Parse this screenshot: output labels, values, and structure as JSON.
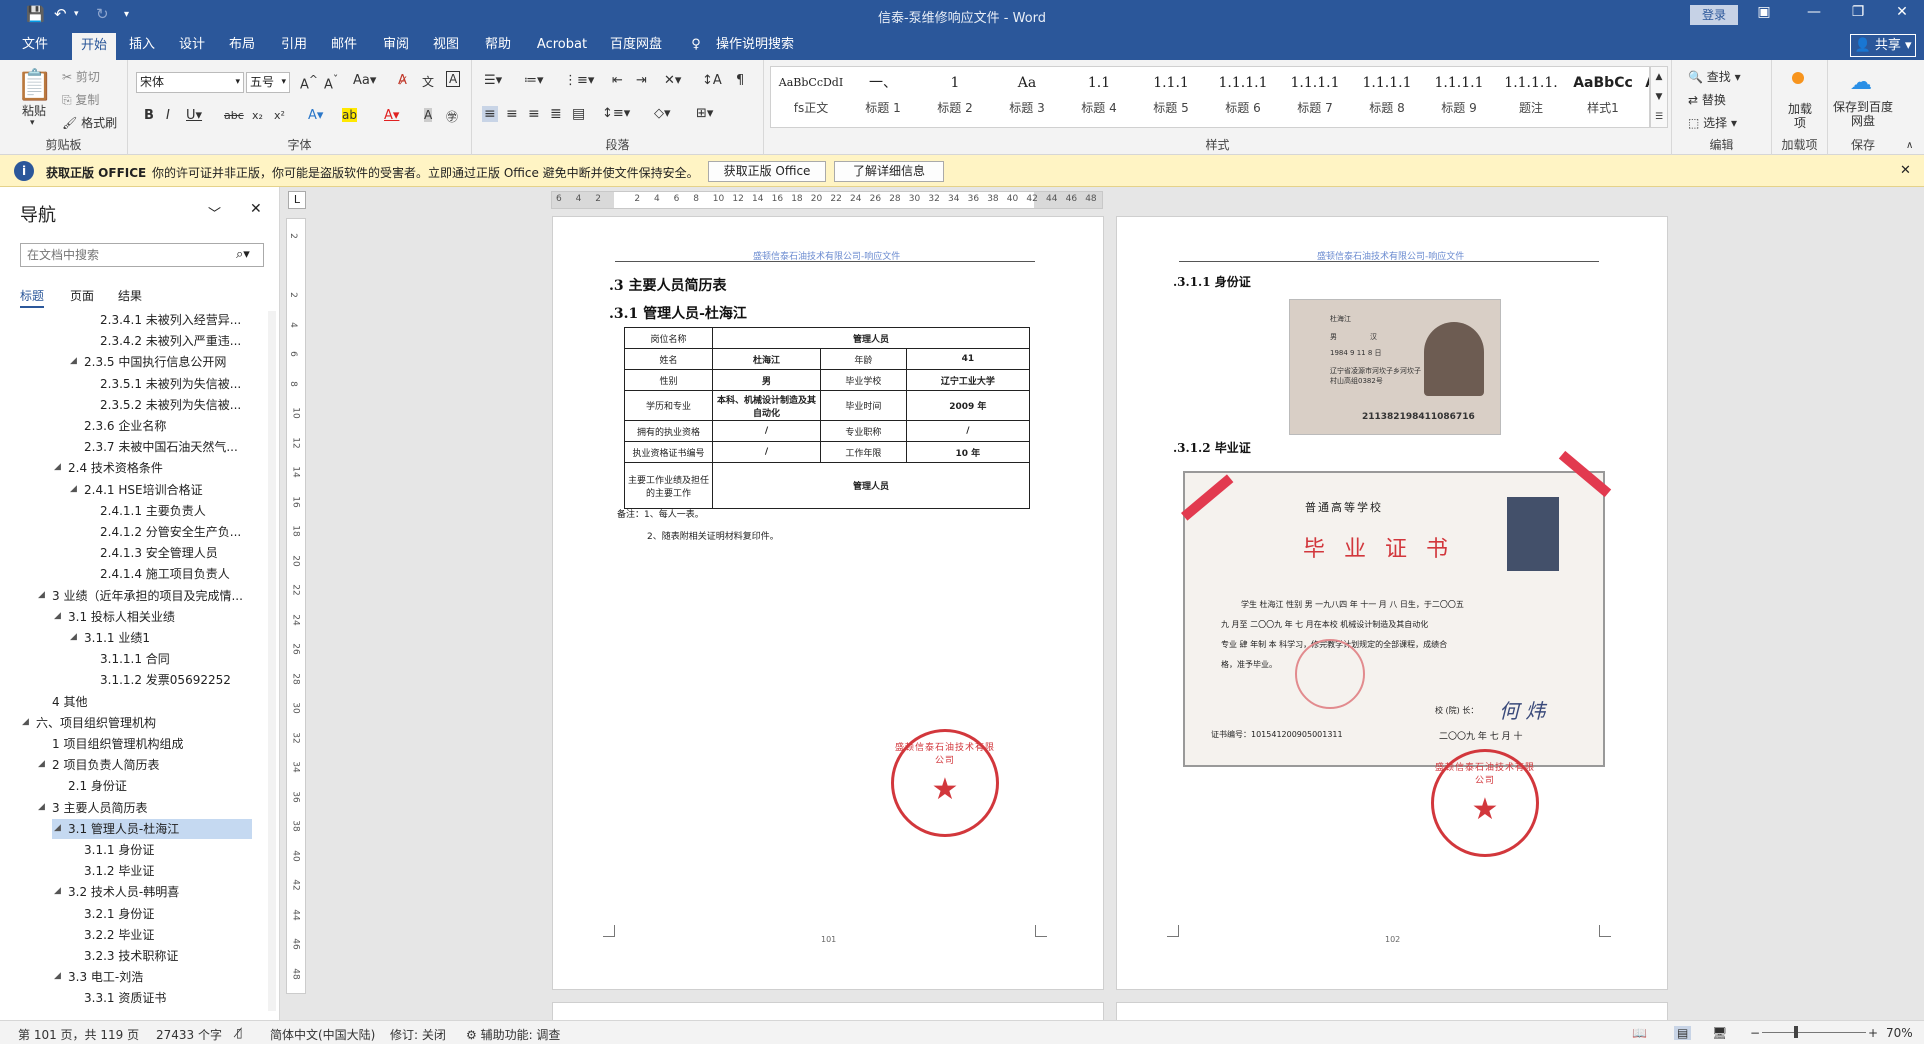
{
  "window": {
    "title": "信泰-泵维修响应文件 - Word",
    "login": "登录"
  },
  "tabs": [
    "文件",
    "开始",
    "插入",
    "设计",
    "布局",
    "引用",
    "邮件",
    "审阅",
    "视图",
    "帮助",
    "Acrobat",
    "百度网盘"
  ],
  "tell_me": "操作说明搜索",
  "share": "共享",
  "clipboard": {
    "paste": "粘贴",
    "cut": "剪切",
    "copy": "复制",
    "format_painter": "格式刷",
    "label": "剪贴板"
  },
  "font": {
    "name": "宋体",
    "size": "五号",
    "label": "字体"
  },
  "paragraph": {
    "label": "段落"
  },
  "styles": {
    "label": "样式",
    "items": [
      {
        "preview": "AaBbCcDdI",
        "name": "fs正文"
      },
      {
        "preview": "一、",
        "name": "标题 1"
      },
      {
        "preview": "1",
        "name": "标题 2"
      },
      {
        "preview": "Aa",
        "name": "标题 3"
      },
      {
        "preview": "1.1",
        "name": "标题 4"
      },
      {
        "preview": "1.1.1",
        "name": "标题 5"
      },
      {
        "preview": "1.1.1.1",
        "name": "标题 6"
      },
      {
        "preview": "1.1.1.1",
        "name": "标题 7"
      },
      {
        "preview": "1.1.1.1",
        "name": "标题 8"
      },
      {
        "preview": "1.1.1.1",
        "name": "标题 9"
      },
      {
        "preview": "1.1.1.1.",
        "name": "题注"
      },
      {
        "preview": "AaBbCc",
        "name": "样式1"
      },
      {
        "preview": "AaBbCc",
        "name": ""
      }
    ]
  },
  "editing": {
    "find": "查找",
    "replace": "替换",
    "select": "选择",
    "label": "编辑"
  },
  "addins": {
    "btn": "加载项",
    "label": "加载项"
  },
  "baidu": {
    "btn": "保存到百度网盘",
    "label": "保存"
  },
  "license": {
    "title": "获取正版 OFFICE",
    "message": "你的许可证并非正版，你可能是盗版软件的受害者。立即通过正版 Office 避免中断并使文件保持安全。",
    "btn1": "获取正版 Office",
    "btn2": "了解详细信息"
  },
  "nav": {
    "title": "导航",
    "search_placeholder": "在文档中搜索",
    "tabs": [
      "标题",
      "页面",
      "结果"
    ],
    "items": [
      {
        "text": "2.3.4.1 未被列入经营异...",
        "level": 3,
        "exp": false
      },
      {
        "text": "2.3.4.2 未被列入严重违...",
        "level": 3,
        "exp": false
      },
      {
        "text": "2.3.5 中国执行信息公开网",
        "level": 2,
        "exp": true
      },
      {
        "text": "2.3.5.1 未被列为失信被...",
        "level": 3,
        "exp": false
      },
      {
        "text": "2.3.5.2 未被列为失信被...",
        "level": 3,
        "exp": false
      },
      {
        "text": "2.3.6 企业名称",
        "level": 2,
        "exp": false
      },
      {
        "text": "2.3.7 未被中国石油天然气...",
        "level": 2,
        "exp": false
      },
      {
        "text": "2.4 技术资格条件",
        "level": 1,
        "exp": true
      },
      {
        "text": "2.4.1 HSE培训合格证",
        "level": 2,
        "exp": true
      },
      {
        "text": "2.4.1.1 主要负责人",
        "level": 3,
        "exp": false
      },
      {
        "text": "2.4.1.2 分管安全生产负...",
        "level": 3,
        "exp": false
      },
      {
        "text": "2.4.1.3 安全管理人员",
        "level": 3,
        "exp": false
      },
      {
        "text": "2.4.1.4 施工项目负责人",
        "level": 3,
        "exp": false
      },
      {
        "text": "3 业绩（近年承担的项目及完成情...",
        "level": 0,
        "exp": true
      },
      {
        "text": "3.1 投标人相关业绩",
        "level": 1,
        "exp": true
      },
      {
        "text": "3.1.1 业绩1",
        "level": 2,
        "exp": true
      },
      {
        "text": "3.1.1.1 合同",
        "level": 3,
        "exp": false
      },
      {
        "text": "3.1.1.2 发票05692252",
        "level": 3,
        "exp": false
      },
      {
        "text": "4 其他",
        "level": 0,
        "exp": false
      },
      {
        "text": "六、项目组织管理机构",
        "level": -1,
        "exp": true
      },
      {
        "text": "1 项目组织管理机构组成",
        "level": 0,
        "exp": false
      },
      {
        "text": "2 项目负责人简历表",
        "level": 0,
        "exp": true
      },
      {
        "text": "2.1 身份证",
        "level": 1,
        "exp": false
      },
      {
        "text": "3 主要人员简历表",
        "level": 0,
        "exp": true
      },
      {
        "text": "3.1 管理人员-杜海江",
        "level": 1,
        "exp": true,
        "selected": true
      },
      {
        "text": "3.1.1 身份证",
        "level": 2,
        "exp": false
      },
      {
        "text": "3.1.2 毕业证",
        "level": 2,
        "exp": false
      },
      {
        "text": "3.2 技术人员-韩明喜",
        "level": 1,
        "exp": true
      },
      {
        "text": "3.2.1 身份证",
        "level": 2,
        "exp": false
      },
      {
        "text": "3.2.2 毕业证",
        "level": 2,
        "exp": false
      },
      {
        "text": "3.2.3 技术职称证",
        "level": 2,
        "exp": false
      },
      {
        "text": "3.3 电工-刘浩",
        "level": 1,
        "exp": true
      },
      {
        "text": "3.3.1 资质证书",
        "level": 2,
        "exp": false
      }
    ]
  },
  "ruler": {
    "h_ticks": [
      "6",
      "4",
      "2",
      "",
      "2",
      "4",
      "6",
      "8",
      "10",
      "12",
      "14",
      "16",
      "18",
      "20",
      "22",
      "24",
      "26",
      "28",
      "30",
      "32",
      "34",
      "36",
      "38",
      "40",
      "42",
      "44",
      "46",
      "48"
    ],
    "v_ticks": [
      "2",
      "",
      "2",
      "4",
      "6",
      "8",
      "10",
      "12",
      "14",
      "16",
      "18",
      "20",
      "22",
      "24",
      "26",
      "28",
      "30",
      "32",
      "34",
      "36",
      "38",
      "40",
      "42",
      "44",
      "46",
      "48"
    ]
  },
  "page1": {
    "header": "盛顿信泰石油技术有限公司-响应文件",
    "h1": ".3   主要人员简历表",
    "h2": ".3.1   管理人员-杜海江",
    "table": {
      "r1": [
        "岗位名称",
        "管理人员"
      ],
      "r2": [
        "姓名",
        "杜海江",
        "年龄",
        "41"
      ],
      "r3": [
        "性别",
        "男",
        "毕业学校",
        "辽宁工业大学"
      ],
      "r4": [
        "学历和专业",
        "本科、机械设计制造及其自动化",
        "毕业时间",
        "2009 年"
      ],
      "r5": [
        "拥有的执业资格",
        "/",
        "专业职称",
        "/"
      ],
      "r6": [
        "执业资格证书编号",
        "/",
        "工作年限",
        "10 年"
      ],
      "r7": [
        "主要工作业绩及担任的主要工作",
        "管理人员"
      ]
    },
    "note1": "备注：1、每人一表。",
    "note2": "2、随表附相关证明材料复印件。",
    "page_num": "101",
    "stamp": "盛顿信泰石油技术有限公司"
  },
  "page2": {
    "header": "盛顿信泰石油技术有限公司-响应文件",
    "h1": ".3.1.1  身份证",
    "h2": ".3.1.2  毕业证",
    "id_card": {
      "name": "杜海江",
      "sex": "男",
      "nation": "汉",
      "birth": "1984  9  11  8 日",
      "address": "辽宁省凌源市河坎子乡河坎子村山高组0382号",
      "number": "211382198411086716"
    },
    "diploma": {
      "school": "普通高等学校",
      "title": "毕 业 证 书",
      "line1": "学生  杜海江  性别 男 一九八四 年 十一 月 八 日生，于二〇〇五",
      "line2": "九 月至 二〇〇九 年 七 月在本校  机械设计制造及其自动化",
      "line3": "专业  肆  年制  本  科学习，修完教学计划规定的全部课程，成绩合",
      "line4": "格，准予毕业。",
      "president": "校 (院) 长：",
      "signature": "何 炜",
      "cert_no": "证书编号：101541200905001311",
      "date": "二〇〇九 年 七 月 十"
    },
    "page_num": "102",
    "stamp": "盛顿信泰石油技术有限公司"
  },
  "status": {
    "page": "第 101 页，共 119 页",
    "words": "27433 个字",
    "lang": "简体中文(中国大陆)",
    "track": "修订: 关闭",
    "access": "辅助功能: 调查",
    "zoom": "70%"
  }
}
